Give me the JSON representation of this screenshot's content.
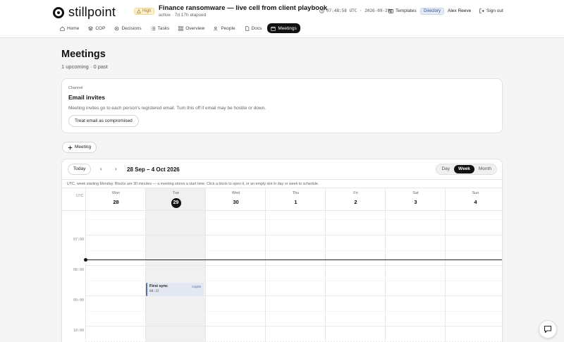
{
  "app": {
    "name": "stillpoint",
    "severity": "High",
    "case_title": "Finance ransomware — live cell from client playbook",
    "case_meta": "active · 7d 17h elapsed",
    "clock": "07:48:58 UTC · 2026-09-29",
    "templates_label": "Templates",
    "directory_label": "Directory",
    "user_name": "Alex Reeve",
    "signout_label": "Sign out"
  },
  "nav": {
    "items": [
      {
        "label": "Home",
        "icon": "home-icon"
      },
      {
        "label": "COP",
        "icon": "layers-icon"
      },
      {
        "label": "Decisions",
        "icon": "decision-icon"
      },
      {
        "label": "Tasks",
        "icon": "tasks-icon"
      },
      {
        "label": "Overview",
        "icon": "grid-icon"
      },
      {
        "label": "People",
        "icon": "people-icon"
      },
      {
        "label": "Docs",
        "icon": "doc-icon"
      },
      {
        "label": "Meetings",
        "icon": "calendar-icon",
        "active": true
      }
    ]
  },
  "page": {
    "title": "Meetings",
    "subtitle": "1 upcoming · 0 past"
  },
  "channel": {
    "kicker": "Channel",
    "heading": "Email invites",
    "description": "Meeting invites go to each person's registered email. Turn this off if email may be hostile or down.",
    "button": "Treat email as compromised"
  },
  "add_meeting": "Meeting",
  "calendar": {
    "today_label": "Today",
    "range": "28 Sep – 4 Oct 2026",
    "views": [
      "Day",
      "Week",
      "Month"
    ],
    "active_view": "Week",
    "note": "UTC, week starting Monday. Blocks are 30 minutes — a meeting stores a start time. Click a block to open it, or an empty slot in day or week to schedule.",
    "tz": "UTC",
    "days": [
      {
        "name": "Mon",
        "num": "28"
      },
      {
        "name": "Tue",
        "num": "29",
        "today": true
      },
      {
        "name": "Wed",
        "num": "30"
      },
      {
        "name": "Thu",
        "num": "1"
      },
      {
        "name": "Fri",
        "num": "2"
      },
      {
        "name": "Sat",
        "num": "3"
      },
      {
        "name": "Sun",
        "num": "4"
      }
    ],
    "hours": [
      "07:00",
      "08:00",
      "09:00",
      "10:00"
    ],
    "event": {
      "title": "First sync",
      "start": "08:32",
      "tag": "Caplist"
    }
  },
  "colors": {
    "accent": "#111111",
    "event_bg": "#e3e8f2",
    "event_border": "#5a6f9a",
    "severity_bg": "#fbf0d4"
  }
}
